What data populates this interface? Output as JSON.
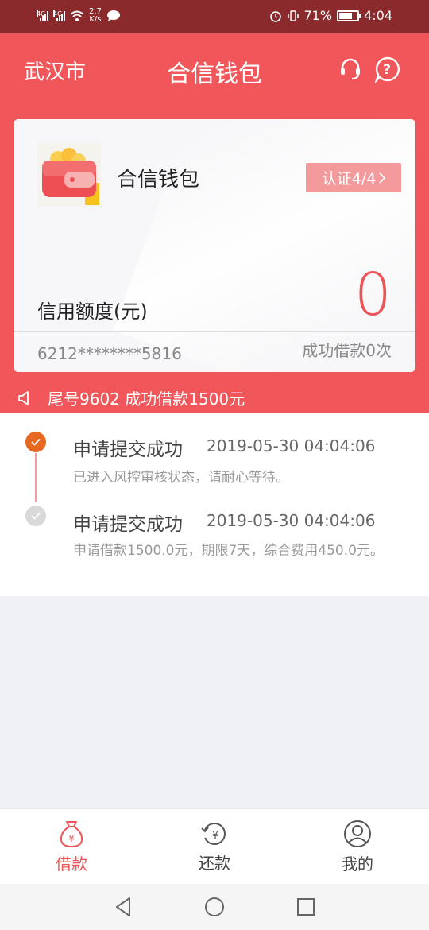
{
  "status_bar": {
    "net1": "4G",
    "net2": "4G",
    "speed_value": "2.7",
    "speed_unit": "K/s",
    "battery": "71%",
    "battery_level": 0.71,
    "time": "4:04"
  },
  "header": {
    "city": "武汉市",
    "title": "合信钱包",
    "icons": [
      "headset-icon",
      "help-icon"
    ]
  },
  "card": {
    "name": "合信钱包",
    "verify_label": "认证4/4",
    "limit_label": "信用额度(元)",
    "limit_value": "0",
    "card_number": "6212********5816",
    "success_count": "成功借款0次"
  },
  "notice": {
    "text": "尾号9602 成功借款1500元"
  },
  "timeline": [
    {
      "title": "申请提交成功",
      "time": "2019-05-30 04:04:06",
      "desc": "已进入风控审核状态，请耐心等待。",
      "status": "active"
    },
    {
      "title": "申请提交成功",
      "time": "2019-05-30 04:04:06",
      "desc": "申请借款1500.0元，期限7天，综合费用450.0元。",
      "status": "done"
    }
  ],
  "tabs": [
    {
      "label": "借款",
      "active": true
    },
    {
      "label": "还款",
      "active": false
    },
    {
      "label": "我的",
      "active": false
    }
  ],
  "colors": {
    "primary": "#f1575a",
    "active_tab": "#ee5558",
    "timeline_active": "#e8681f"
  }
}
